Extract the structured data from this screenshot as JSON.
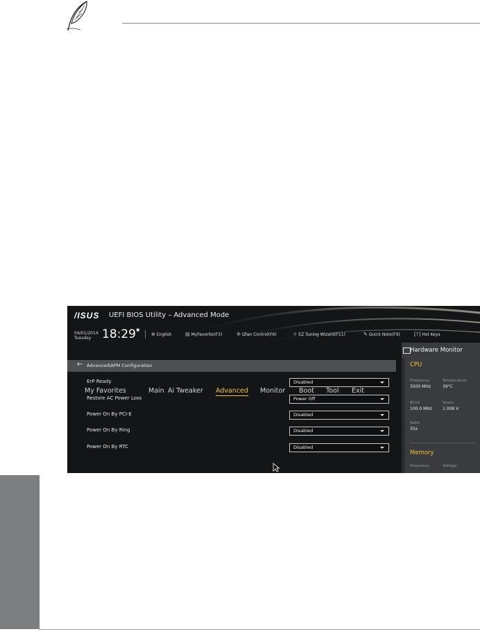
{
  "bios": {
    "brand": "/ISUS",
    "title": "UEFI BIOS Utility – Advanced Mode",
    "date": "04/01/2014",
    "day": "Tuesday",
    "time": "18:29",
    "toolbar": [
      {
        "icon": "globe-icon",
        "label": "English"
      },
      {
        "icon": "favorite-icon",
        "label": "MyFavorite(F3)"
      },
      {
        "icon": "fan-icon",
        "label": "Qfan Control(F6)"
      },
      {
        "icon": "lightbulb-icon",
        "label": "EZ Tuning Wizard(F11)"
      },
      {
        "icon": "note-icon",
        "label": "Quick Note(F9)"
      },
      {
        "icon": "help-icon",
        "label": "Hot Keys"
      }
    ],
    "menu": [
      "My Favorites",
      "Main",
      "Ai Tweaker",
      "Advanced",
      "Monitor",
      "Boot",
      "Tool",
      "Exit"
    ],
    "active_menu": "Advanced",
    "breadcrumb": "Advanced\\APM Configuration",
    "settings": [
      {
        "label": "ErP Ready",
        "value": "Disabled"
      },
      {
        "label": "Restore AC Power Loss",
        "value": "Power Off"
      },
      {
        "label": "Power On By PCI-E",
        "value": "Disabled"
      },
      {
        "label": "Power On By Ring",
        "value": "Disabled"
      },
      {
        "label": "Power On By RTC",
        "value": "Disabled"
      }
    ],
    "hardware_monitor": {
      "title": "Hardware Monitor",
      "cpu_title": "CPU",
      "cpu": {
        "frequency_label": "Frequency",
        "frequency": "3500 MHz",
        "temperature_label": "Temperature",
        "temperature": "39°C",
        "bclk_label": "BCLK",
        "bclk": "100.0 MHz",
        "vcore_label": "Vcore",
        "vcore": "1.008 V",
        "ratio_label": "Ratio",
        "ratio": "35x"
      },
      "memory_title": "Memory",
      "memory": {
        "frequency_label": "Frequency",
        "voltage_label": "Voltage"
      }
    }
  },
  "colors": {
    "accent": "#f2c230",
    "bios_background": "#141517",
    "side_tab": "#7d7e80"
  }
}
